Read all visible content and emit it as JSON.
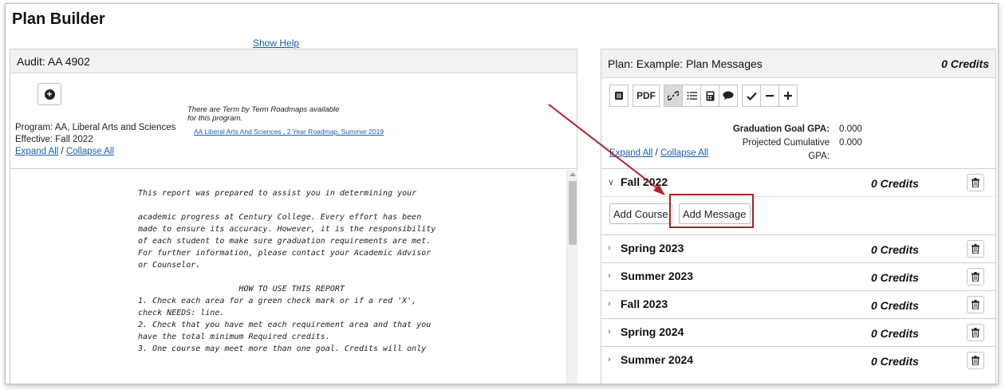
{
  "page": {
    "title": "Plan Builder",
    "show_help": "Show Help"
  },
  "audit": {
    "title": "Audit: AA 4902",
    "program": "Program: AA, Liberal Arts and Sciences",
    "effective": "Effective: Fall 2022",
    "expand_all": "Expand All",
    "separator": " / ",
    "collapse_all": "Collapse All",
    "roadmap_note": "There are Term by Term Roadmaps available for this program.",
    "roadmap_link": "AA Liberal Arts And Sciences , 2 Year Roadmap, Summer 2019",
    "report_text": "This report was prepared to assist you in determining your\n\nacademic progress at Century College. Every effort has been\nmade to ensure its accuracy. However, it is the responsibility\nof each student to make sure graduation requirements are met.\nFor further information, please contact your Academic Advisor\nor Counselor.\n\n                     HOW TO USE THIS REPORT\n1. Check each area for a green check mark or if a red 'X',\ncheck NEEDS: line.\n2. Check that you have met each requirement area and that you\nhave the total minimum Required credits.\n3. One course may meet more than one goal. Credits will only"
  },
  "plan": {
    "title": "Plan: Example: Plan Messages",
    "credits": "0 Credits",
    "toolbar": {
      "pdf_label": "PDF"
    },
    "gpa": {
      "goal_label": "Graduation Goal GPA:",
      "goal_value": "0.000",
      "projected_label": "Projected Cumulative GPA:",
      "projected_value": "0.000"
    },
    "expand_all": "Expand All",
    "separator": " / ",
    "collapse_all": "Collapse All",
    "add_course": "Add Course",
    "add_message": "Add Message",
    "terms": [
      {
        "name": "Fall 2022",
        "credits": "0 Credits",
        "expanded": true
      },
      {
        "name": "Spring 2023",
        "credits": "0 Credits",
        "expanded": false
      },
      {
        "name": "Summer 2023",
        "credits": "0 Credits",
        "expanded": false
      },
      {
        "name": "Fall 2023",
        "credits": "0 Credits",
        "expanded": false
      },
      {
        "name": "Spring 2024",
        "credits": "0 Credits",
        "expanded": false
      },
      {
        "name": "Summer 2024",
        "credits": "0 Credits",
        "expanded": false
      }
    ]
  },
  "annotation": {
    "color": "#b21f24"
  }
}
